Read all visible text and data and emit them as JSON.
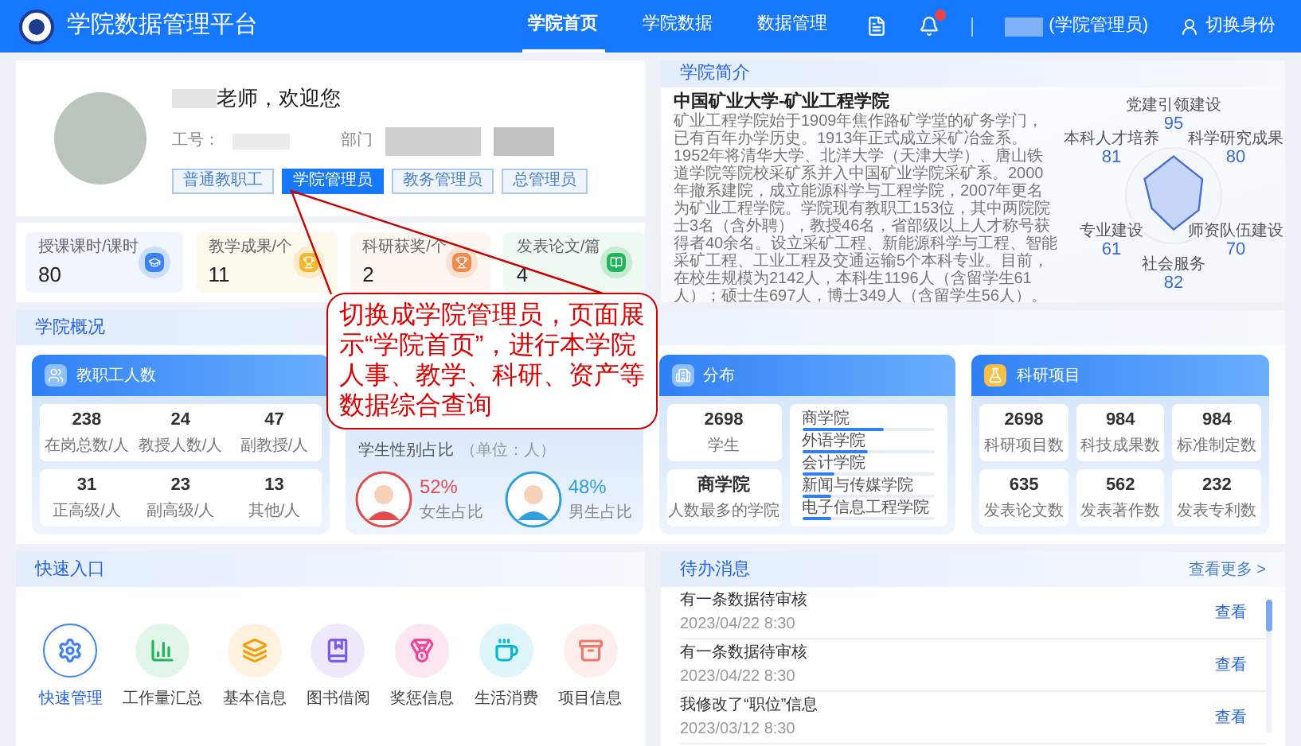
{
  "header": {
    "title": "学院数据管理平台",
    "nav": [
      {
        "label": "学院首页",
        "selected": true
      },
      {
        "label": "学院数据",
        "selected": false
      },
      {
        "label": "数据管理",
        "selected": false
      }
    ],
    "user_role": "(学院管理员)",
    "switch_label": "切换身份"
  },
  "profile": {
    "greeting": "老师，欢迎您",
    "id_label": "工号：",
    "dept_label": "部门",
    "roles": [
      {
        "label": "普通教职工",
        "selected": false
      },
      {
        "label": "学院管理员",
        "selected": true
      },
      {
        "label": "教务管理员",
        "selected": false
      },
      {
        "label": "总管理员",
        "selected": false
      }
    ]
  },
  "stats": [
    {
      "label": "授课课时/课时",
      "value": "80",
      "color": "#3b82f6"
    },
    {
      "label": "教学成果/个",
      "value": "11",
      "color": "#f5b731"
    },
    {
      "label": "科研获奖/个",
      "value": "2",
      "color": "#f08a4b"
    },
    {
      "label": "发表论文/篇",
      "value": "4",
      "color": "#22b45a"
    }
  ],
  "intro": {
    "title": "学院简介",
    "school": "中国矿业大学-矿业工程学院",
    "text": "矿业工程学院始于1909年焦作路矿学堂的矿务学门，已有百年办学历史。1913年正式成立采矿冶金系。1952年将清华大学、北洋大学（天津大学）、唐山铁道学院等院校采矿系并入中国矿业学院采矿系。2000年撤系建院，成立能源科学与工程学院，2007年更名为矿业工程学院。学院现有教职工153位，其中两院院士3名（含外聘），教授46名，省部级以上人才称号获得者40余名。设立采矿工程、新能源科学与工程、智能采矿工程、工业工程及交通运输5个本科专业。目前，在校生规模为2142人，本科生1196人（含留学生61人）；硕士生697人，博士349人（含留学生56人）。",
    "radar": [
      {
        "name": "党建引领建设",
        "value": "95"
      },
      {
        "name": "本科人才培养",
        "value": "81"
      },
      {
        "name": "科学研究成果",
        "value": "80"
      },
      {
        "name": "专业建设",
        "value": "61"
      },
      {
        "name": "师资队伍建设",
        "value": "70"
      },
      {
        "name": "社会服务",
        "value": "82"
      }
    ]
  },
  "overview": {
    "title": "学院概况",
    "staff": {
      "title": "教职工人数",
      "tiles": [
        {
          "value": "238",
          "label": "在岗总数/人"
        },
        {
          "value": "24",
          "label": "教授人数/人"
        },
        {
          "value": "47",
          "label": "副教授/人"
        },
        {
          "value": "31",
          "label": "正高级/人"
        },
        {
          "value": "23",
          "label": "副高级/人"
        },
        {
          "value": "13",
          "label": "其他/人"
        }
      ]
    },
    "students": {
      "gender_title": "学生性别占比",
      "gender_unit": "（单位：人）",
      "female": {
        "percent": "52%",
        "label": "女生占比"
      },
      "male": {
        "percent": "48%",
        "label": "男生占比"
      }
    },
    "departments": {
      "title": "分布",
      "tiles": [
        {
          "value": "2698",
          "label": "学生"
        },
        {
          "value": "商学院",
          "label": "人数最多的学院"
        }
      ],
      "bars": [
        {
          "name": "商学院",
          "level": 0.62
        },
        {
          "name": "外语学院",
          "level": 0.5
        },
        {
          "name": "会计学院",
          "level": 0.24
        },
        {
          "name": "新闻与传媒学院",
          "level": 0.22
        },
        {
          "name": "电子信息工程学院",
          "level": 0.22
        }
      ]
    },
    "research": {
      "title": "科研项目",
      "tiles": [
        {
          "value": "2698",
          "label": "科研项目数"
        },
        {
          "value": "984",
          "label": "科技成果数"
        },
        {
          "value": "984",
          "label": "标准制定数"
        },
        {
          "value": "635",
          "label": "发表论文数"
        },
        {
          "value": "562",
          "label": "发表著作数"
        },
        {
          "value": "232",
          "label": "发表专利数"
        }
      ]
    }
  },
  "quick": {
    "title": "快速入口",
    "items": [
      {
        "label": "快速管理",
        "kind": "settings",
        "color": "#3b82f6",
        "selected": true
      },
      {
        "label": "工作量汇总",
        "kind": "chart",
        "color": "#22b45a",
        "selected": false
      },
      {
        "label": "基本信息",
        "kind": "layers",
        "color": "#f59e0b",
        "selected": false
      },
      {
        "label": "图书借阅",
        "kind": "book",
        "color": "#7c5cf0",
        "selected": false
      },
      {
        "label": "奖惩信息",
        "kind": "medal",
        "color": "#ec4899",
        "selected": false
      },
      {
        "label": "生活消费",
        "kind": "cup",
        "color": "#06b6d4",
        "selected": false
      },
      {
        "label": "项目信息",
        "kind": "archive",
        "color": "#f0776b",
        "selected": false
      }
    ]
  },
  "todo": {
    "title": "待办消息",
    "more": "查看更多 >",
    "items": [
      {
        "text": "有一条数据待审核",
        "time": "2023/04/22  8:30",
        "action": "查看"
      },
      {
        "text": "有一条数据待审核",
        "time": "2023/04/22  8:30",
        "action": "查看"
      },
      {
        "text": "我修改了“职位”信息",
        "time": "2023/03/12  8:30",
        "action": "查看"
      }
    ]
  },
  "callout": {
    "text": "切换成学院管理员，页面展示“学院首页”，进行本学院人事、教学、科研、资产等数据综合查询"
  }
}
